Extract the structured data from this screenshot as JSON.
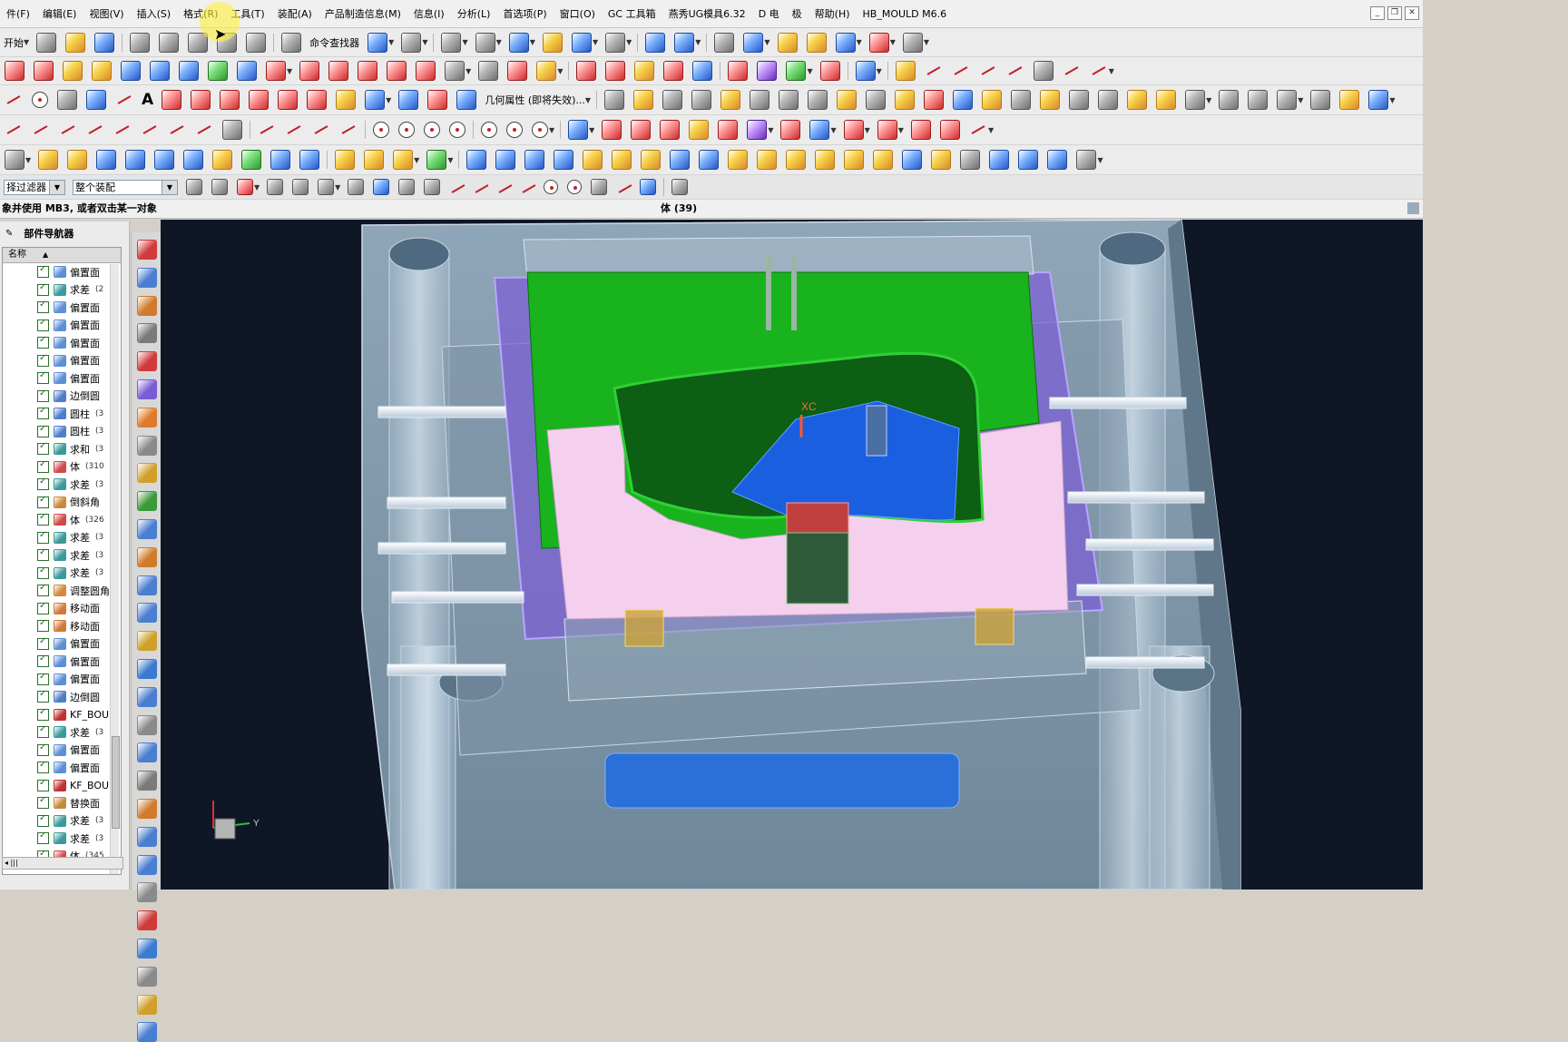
{
  "menu": {
    "items": [
      "件(F)",
      "编辑(E)",
      "视图(V)",
      "插入(S)",
      "格式(R)",
      "工具(T)",
      "装配(A)",
      "产品制造信息(M)",
      "信息(I)",
      "分析(L)",
      "首选项(P)",
      "窗口(O)",
      "GC 工具箱",
      "燕秀UG模具6.32",
      "D 电",
      "极",
      "帮助(H)",
      "HB_MOULD M6.6"
    ]
  },
  "toolbar": {
    "start_label": "开始",
    "command_finder_label": "命令查找器",
    "geom_props_label": "几何属性 (即将失效)...",
    "filter_label": "择过滤器",
    "assembly_scope_label": "整个装配"
  },
  "cue_line": {
    "message": "象并使用 MB3, 或者双击某一对象",
    "status": "体 (39)"
  },
  "navigator": {
    "title": "部件导航器",
    "column_name": "名称",
    "features": [
      {
        "name": "偏置面",
        "num": "",
        "color": "#5d8fd6"
      },
      {
        "name": "求差",
        "num": "(2",
        "color": "#3a9a9a"
      },
      {
        "name": "偏置面",
        "num": "",
        "color": "#5d8fd6"
      },
      {
        "name": "偏置面",
        "num": "",
        "color": "#5d8fd6"
      },
      {
        "name": "偏置面",
        "num": "",
        "color": "#5d8fd6"
      },
      {
        "name": "偏置面",
        "num": "",
        "color": "#5d8fd6"
      },
      {
        "name": "偏置面",
        "num": "",
        "color": "#5d8fd6"
      },
      {
        "name": "边倒圆",
        "num": "",
        "color": "#4f7ec8"
      },
      {
        "name": "圆柱",
        "num": "(3",
        "color": "#4f7ec8"
      },
      {
        "name": "圆柱",
        "num": "(3",
        "color": "#4f7ec8"
      },
      {
        "name": "求和",
        "num": "(3",
        "color": "#3a9a9a"
      },
      {
        "name": "体",
        "num": "(310",
        "color": "#d04a4a"
      },
      {
        "name": "求差",
        "num": "(3",
        "color": "#3a9a9a"
      },
      {
        "name": "倒斜角",
        "num": "",
        "color": "#c78a3a"
      },
      {
        "name": "体",
        "num": "(326",
        "color": "#d04a4a"
      },
      {
        "name": "求差",
        "num": "(3",
        "color": "#3a9a9a"
      },
      {
        "name": "求差",
        "num": "(3",
        "color": "#3a9a9a"
      },
      {
        "name": "求差",
        "num": "(3",
        "color": "#3a9a9a"
      },
      {
        "name": "调整圆角",
        "num": "",
        "color": "#d08a3a"
      },
      {
        "name": "移动面",
        "num": "",
        "color": "#d07a3a"
      },
      {
        "name": "移动面",
        "num": "",
        "color": "#d07a3a"
      },
      {
        "name": "偏置面",
        "num": "",
        "color": "#5d8fd6"
      },
      {
        "name": "偏置面",
        "num": "",
        "color": "#5d8fd6"
      },
      {
        "name": "偏置面",
        "num": "",
        "color": "#5d8fd6"
      },
      {
        "name": "边倒圆",
        "num": "",
        "color": "#4f7ec8"
      },
      {
        "name": "KF_BOUN",
        "num": "",
        "color": "#c03030"
      },
      {
        "name": "求差",
        "num": "(3",
        "color": "#3a9a9a"
      },
      {
        "name": "偏置面",
        "num": "",
        "color": "#5d8fd6"
      },
      {
        "name": "偏置面",
        "num": "",
        "color": "#5d8fd6"
      },
      {
        "name": "KF_BOUN",
        "num": "",
        "color": "#c03030"
      },
      {
        "name": "替换面",
        "num": "",
        "color": "#c78a3a"
      },
      {
        "name": "求差",
        "num": "(3",
        "color": "#3a9a9a"
      },
      {
        "name": "求差",
        "num": "(3",
        "color": "#3a9a9a"
      },
      {
        "name": "体",
        "num": "(345",
        "color": "#d04a4a"
      }
    ]
  },
  "viewport": {
    "triad_y_label": "Y",
    "wcs_label": "XC"
  },
  "colors": {
    "viewport_bg": "#0f1726",
    "core_green": "#19b31e",
    "parting_pink": "#f4cfee",
    "plate_purple": "#7a5cd6",
    "slider_blue": "#1a5fe0"
  }
}
